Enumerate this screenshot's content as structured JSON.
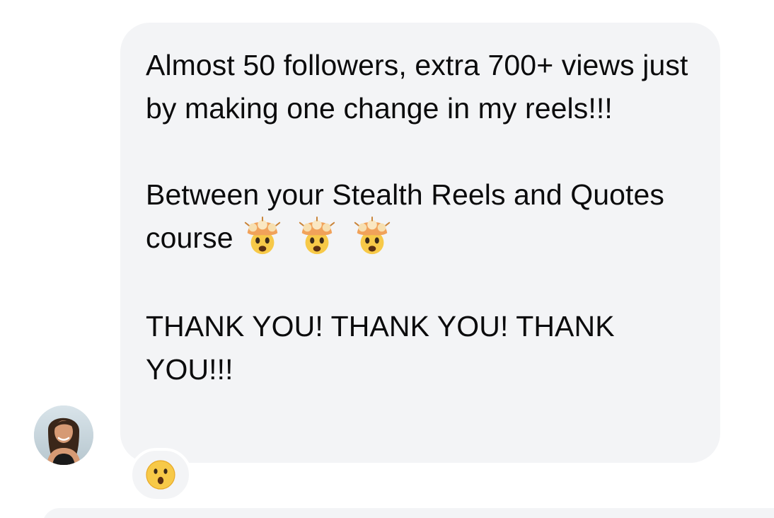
{
  "message": {
    "paragraph_1": "Almost 50 followers, extra 700+ views just by making one change in my reels!!!",
    "paragraph_2_text": "Between your Stealth Reels and Quotes course",
    "paragraph_2_emojis": [
      "exploding-head-emoji",
      "exploding-head-emoji",
      "exploding-head-emoji"
    ],
    "paragraph_3": "THANK YOU! THANK YOU! THANK YOU!!!"
  },
  "reaction": {
    "icon": "surprised-face-emoji"
  },
  "colors": {
    "bubble_background": "#f3f4f6",
    "text": "#0b0b0c",
    "emoji_yellow": "#f7c948"
  }
}
